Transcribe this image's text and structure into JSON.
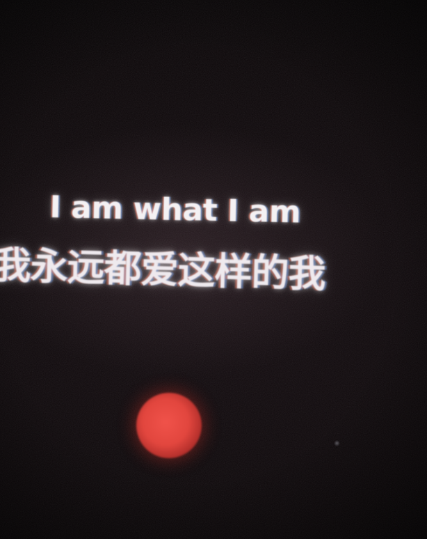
{
  "photo": {
    "caption_line_1": "I am what I am",
    "caption_line_2": "我永远都爱这样的我"
  },
  "colors": {
    "background": "#0b0709",
    "text": "#f4f1f3",
    "light_spot": "#e2463e"
  }
}
